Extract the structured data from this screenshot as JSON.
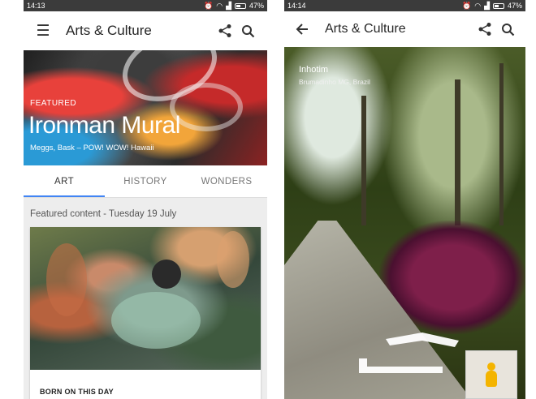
{
  "screen1": {
    "status": {
      "time": "14:13",
      "battery": "47%"
    },
    "appbar": {
      "title": "Arts & Culture",
      "menu_icon": "menu-icon",
      "share_icon": "share-icon",
      "search_icon": "search-icon"
    },
    "hero": {
      "featured_label": "FEATURED",
      "title": "Ironman Mural",
      "subtitle": "Meggs, Bask – POW! WOW! Hawaii"
    },
    "tabs": [
      {
        "label": "ART",
        "active": true
      },
      {
        "label": "HISTORY",
        "active": false
      },
      {
        "label": "WONDERS",
        "active": false
      }
    ],
    "section_heading": "Featured content - Tuesday 19 July",
    "card": {
      "label": "BORN ON THIS DAY"
    }
  },
  "screen2": {
    "status": {
      "time": "14:14",
      "battery": "47%"
    },
    "appbar": {
      "title": "Arts & Culture",
      "back_icon": "back-arrow-icon",
      "share_icon": "share-icon",
      "search_icon": "search-icon"
    },
    "place": {
      "name": "Inhotim",
      "location": "Brumadinho MG, Brazil"
    }
  },
  "colors": {
    "tab_indicator": "#4285f4",
    "status_bar": "#3b3b3b",
    "pegman": "#f4b400"
  }
}
